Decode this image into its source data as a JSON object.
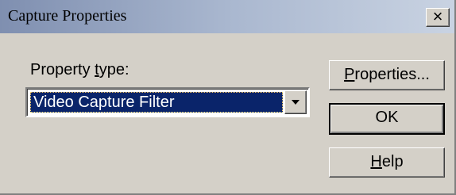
{
  "window": {
    "title": "Capture Properties",
    "close_glyph": "×"
  },
  "property_type": {
    "label_prefix": "Property ",
    "label_mnemonic": "t",
    "label_suffix": "ype:",
    "selected_value": "Video Capture Filter"
  },
  "buttons": {
    "properties": {
      "mnemonic": "P",
      "rest": "roperties..."
    },
    "ok": {
      "label": "OK"
    },
    "help": {
      "mnemonic": "H",
      "rest": "elp"
    }
  },
  "icons": {
    "close": "close-icon",
    "dropdown": "chevron-down-icon"
  },
  "colors": {
    "dialog_face": "#d4d0c8",
    "selection": "#0a246a",
    "selection_text": "#ffffff"
  }
}
